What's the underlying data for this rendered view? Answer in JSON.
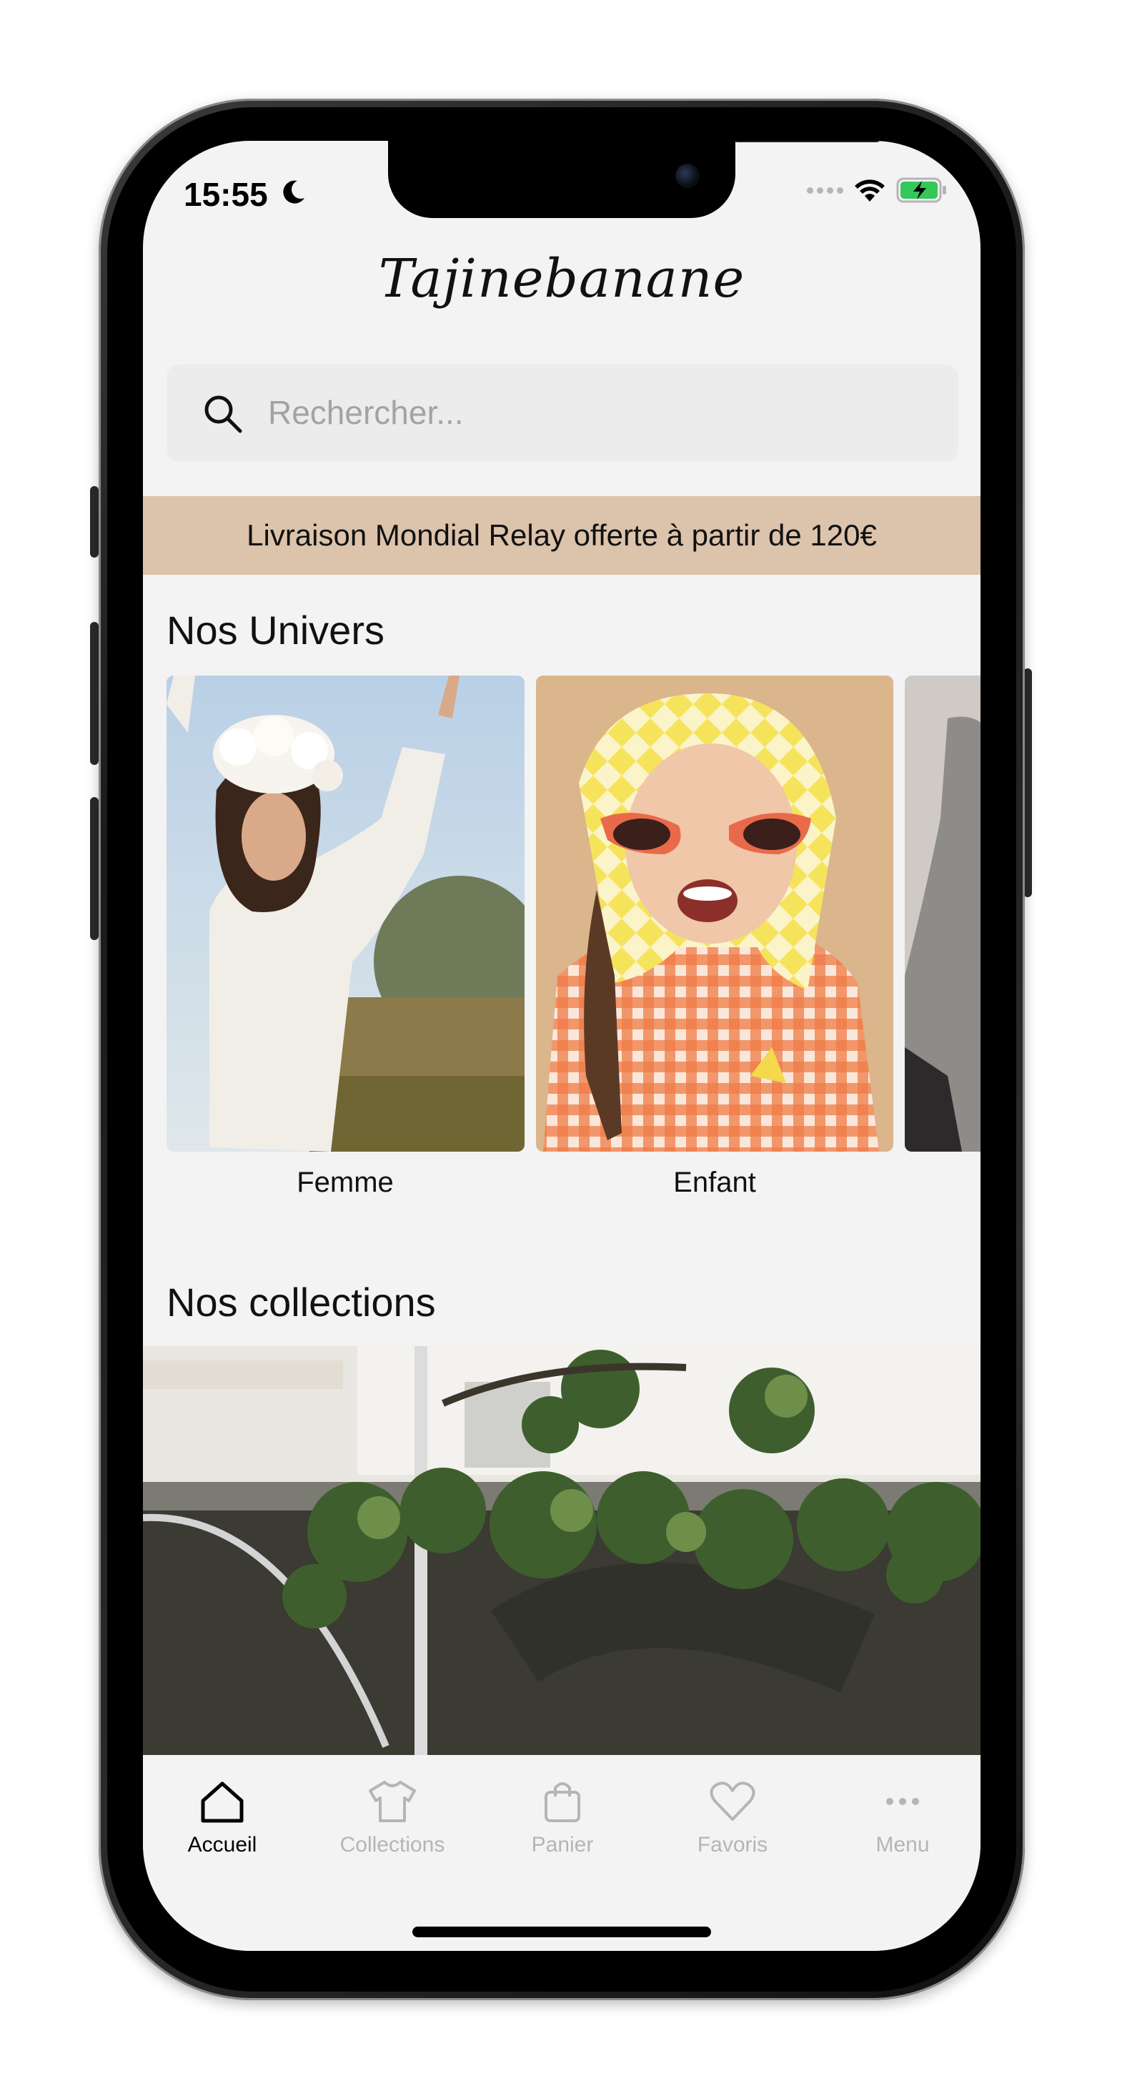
{
  "status_bar": {
    "time": "15:55"
  },
  "brand": {
    "logo_text": "Tajinebanane"
  },
  "search": {
    "placeholder": "Rechercher..."
  },
  "promo_banner": {
    "text": "Livraison Mondial Relay offerte à partir de 120€",
    "background": "#dcc3ab"
  },
  "univers": {
    "title": "Nos Univers",
    "items": [
      {
        "label": "Femme"
      },
      {
        "label": "Enfant"
      }
    ]
  },
  "collections": {
    "title": "Nos collections"
  },
  "tabbar": {
    "active_color": "#000000",
    "inactive_color": "#b5b5b5",
    "items": [
      {
        "label": "Accueil",
        "icon": "home-icon",
        "active": true
      },
      {
        "label": "Collections",
        "icon": "tshirt-icon",
        "active": false
      },
      {
        "label": "Panier",
        "icon": "bag-icon",
        "active": false
      },
      {
        "label": "Favoris",
        "icon": "heart-icon",
        "active": false
      },
      {
        "label": "Menu",
        "icon": "more-icon",
        "active": false
      }
    ]
  }
}
